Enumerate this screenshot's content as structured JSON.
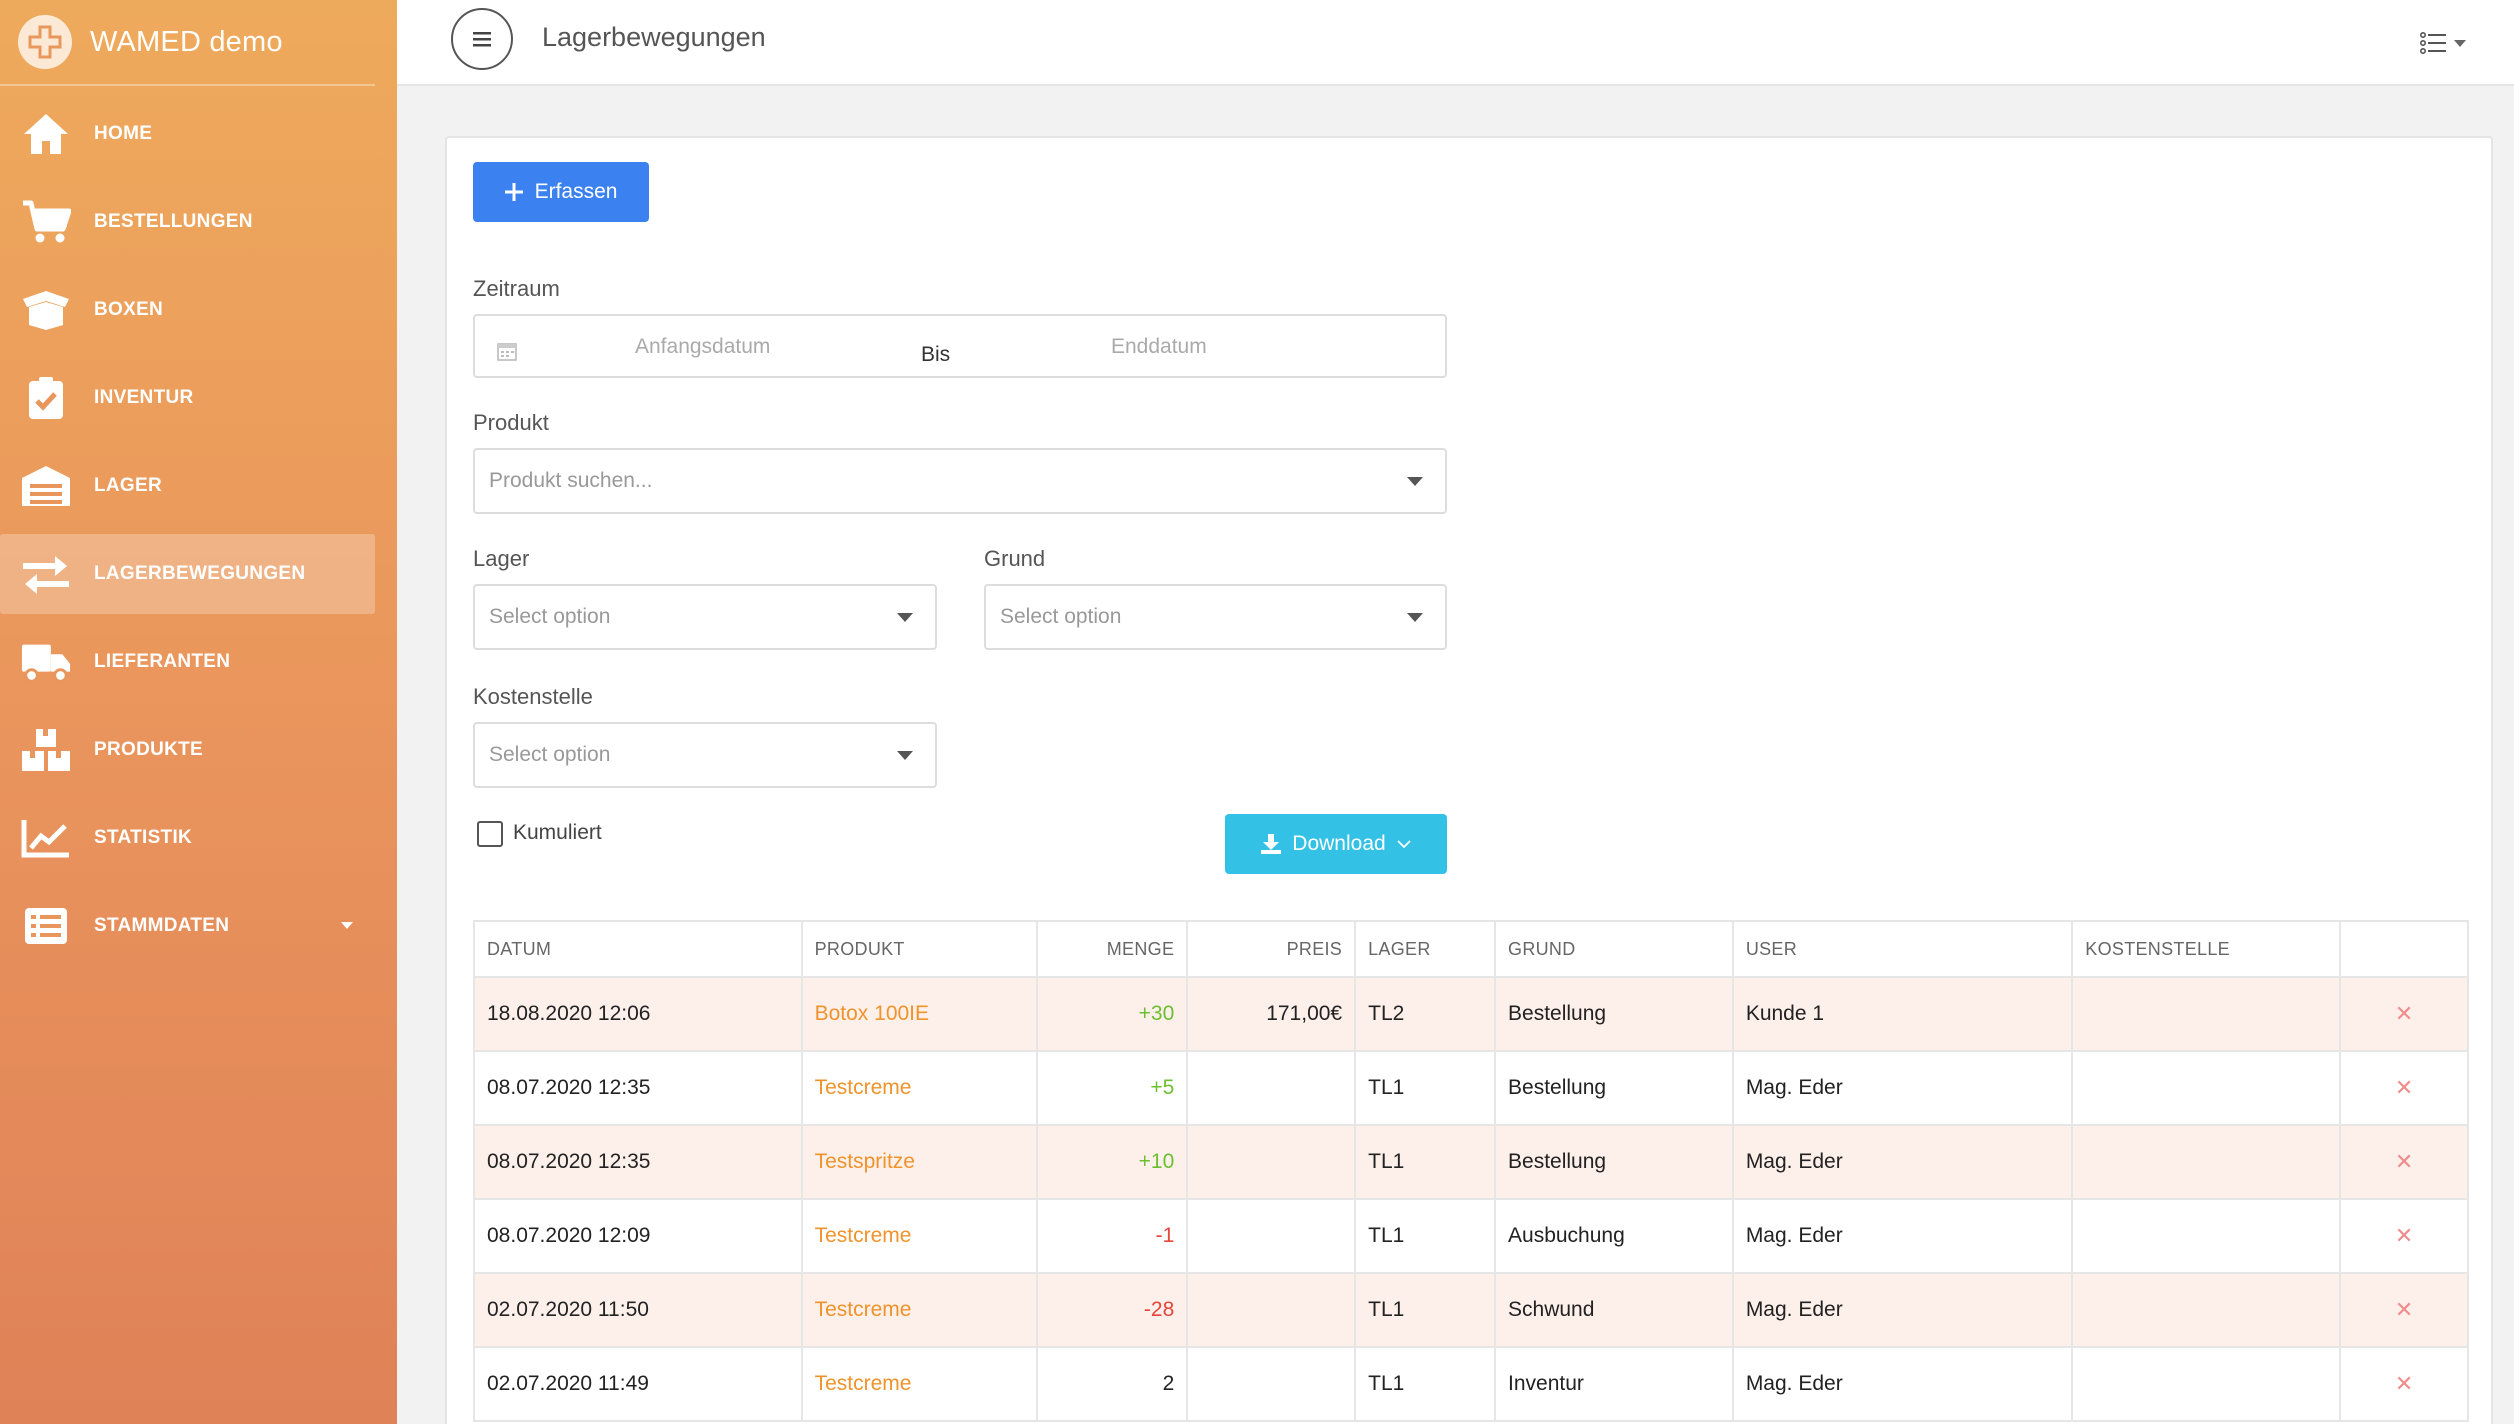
{
  "brand": {
    "title": "WAMED demo"
  },
  "sidebar": {
    "items": [
      {
        "label": "HOME",
        "icon": "home-icon"
      },
      {
        "label": "BESTELLUNGEN",
        "icon": "cart-icon"
      },
      {
        "label": "BOXEN",
        "icon": "box-icon"
      },
      {
        "label": "INVENTUR",
        "icon": "clipboard-check-icon"
      },
      {
        "label": "LAGER",
        "icon": "warehouse-icon"
      },
      {
        "label": "LAGERBEWEGUNGEN",
        "icon": "exchange-arrows-icon",
        "active": true
      },
      {
        "label": "LIEFERANTEN",
        "icon": "truck-icon"
      },
      {
        "label": "PRODUKTE",
        "icon": "boxes-icon"
      },
      {
        "label": "STATISTIK",
        "icon": "chart-line-icon"
      },
      {
        "label": "STAMMDATEN",
        "icon": "list-icon",
        "has_submenu": true
      }
    ]
  },
  "header": {
    "title": "Lagerbewegungen"
  },
  "actions": {
    "create_label": "Erfassen",
    "download_label": "Download"
  },
  "filters": {
    "zeitraum": {
      "label": "Zeitraum",
      "start_placeholder": "Anfangsdatum",
      "separator": "Bis",
      "end_placeholder": "Enddatum"
    },
    "produkt": {
      "label": "Produkt",
      "placeholder": "Produkt suchen..."
    },
    "lager": {
      "label": "Lager",
      "placeholder": "Select option"
    },
    "grund": {
      "label": "Grund",
      "placeholder": "Select option"
    },
    "kostenstelle": {
      "label": "Kostenstelle",
      "placeholder": "Select option"
    },
    "kumuliert": {
      "label": "Kumuliert",
      "checked": false
    }
  },
  "table": {
    "columns": [
      "DATUM",
      "PRODUKT",
      "MENGE",
      "PREIS",
      "LAGER",
      "GRUND",
      "USER",
      "KOSTENSTELLE",
      ""
    ],
    "rows": [
      {
        "datum": "18.08.2020 12:06",
        "produkt": "Botox 100IE",
        "menge": "+30",
        "menge_type": "pos",
        "preis": "171,00€",
        "lager": "TL2",
        "grund": "Bestellung",
        "user": "Kunde 1",
        "kostenstelle": ""
      },
      {
        "datum": "08.07.2020 12:35",
        "produkt": "Testcreme",
        "menge": "+5",
        "menge_type": "pos",
        "preis": "",
        "lager": "TL1",
        "grund": "Bestellung",
        "user": "Mag. Eder",
        "kostenstelle": ""
      },
      {
        "datum": "08.07.2020 12:35",
        "produkt": "Testspritze",
        "menge": "+10",
        "menge_type": "pos",
        "preis": "",
        "lager": "TL1",
        "grund": "Bestellung",
        "user": "Mag. Eder",
        "kostenstelle": ""
      },
      {
        "datum": "08.07.2020 12:09",
        "produkt": "Testcreme",
        "menge": "-1",
        "menge_type": "neg",
        "preis": "",
        "lager": "TL1",
        "grund": "Ausbuchung",
        "user": "Mag. Eder",
        "kostenstelle": ""
      },
      {
        "datum": "02.07.2020 11:50",
        "produkt": "Testcreme",
        "menge": "-28",
        "menge_type": "neg",
        "preis": "",
        "lager": "TL1",
        "grund": "Schwund",
        "user": "Mag. Eder",
        "kostenstelle": ""
      },
      {
        "datum": "02.07.2020 11:49",
        "produkt": "Testcreme",
        "menge": "2",
        "menge_type": "neutral",
        "preis": "",
        "lager": "TL1",
        "grund": "Inventur",
        "user": "Mag. Eder",
        "kostenstelle": ""
      }
    ],
    "delete_symbol": "✕"
  },
  "colors": {
    "sidebar_gradient_top": "#eeaa5c",
    "sidebar_gradient_bottom": "#df8258",
    "primary": "#3b82f0",
    "download": "#33c1e6",
    "product_link": "#f0932b",
    "positive": "#6cbf2f",
    "negative": "#e5453a",
    "row_highlight": "#fdf0ea"
  }
}
